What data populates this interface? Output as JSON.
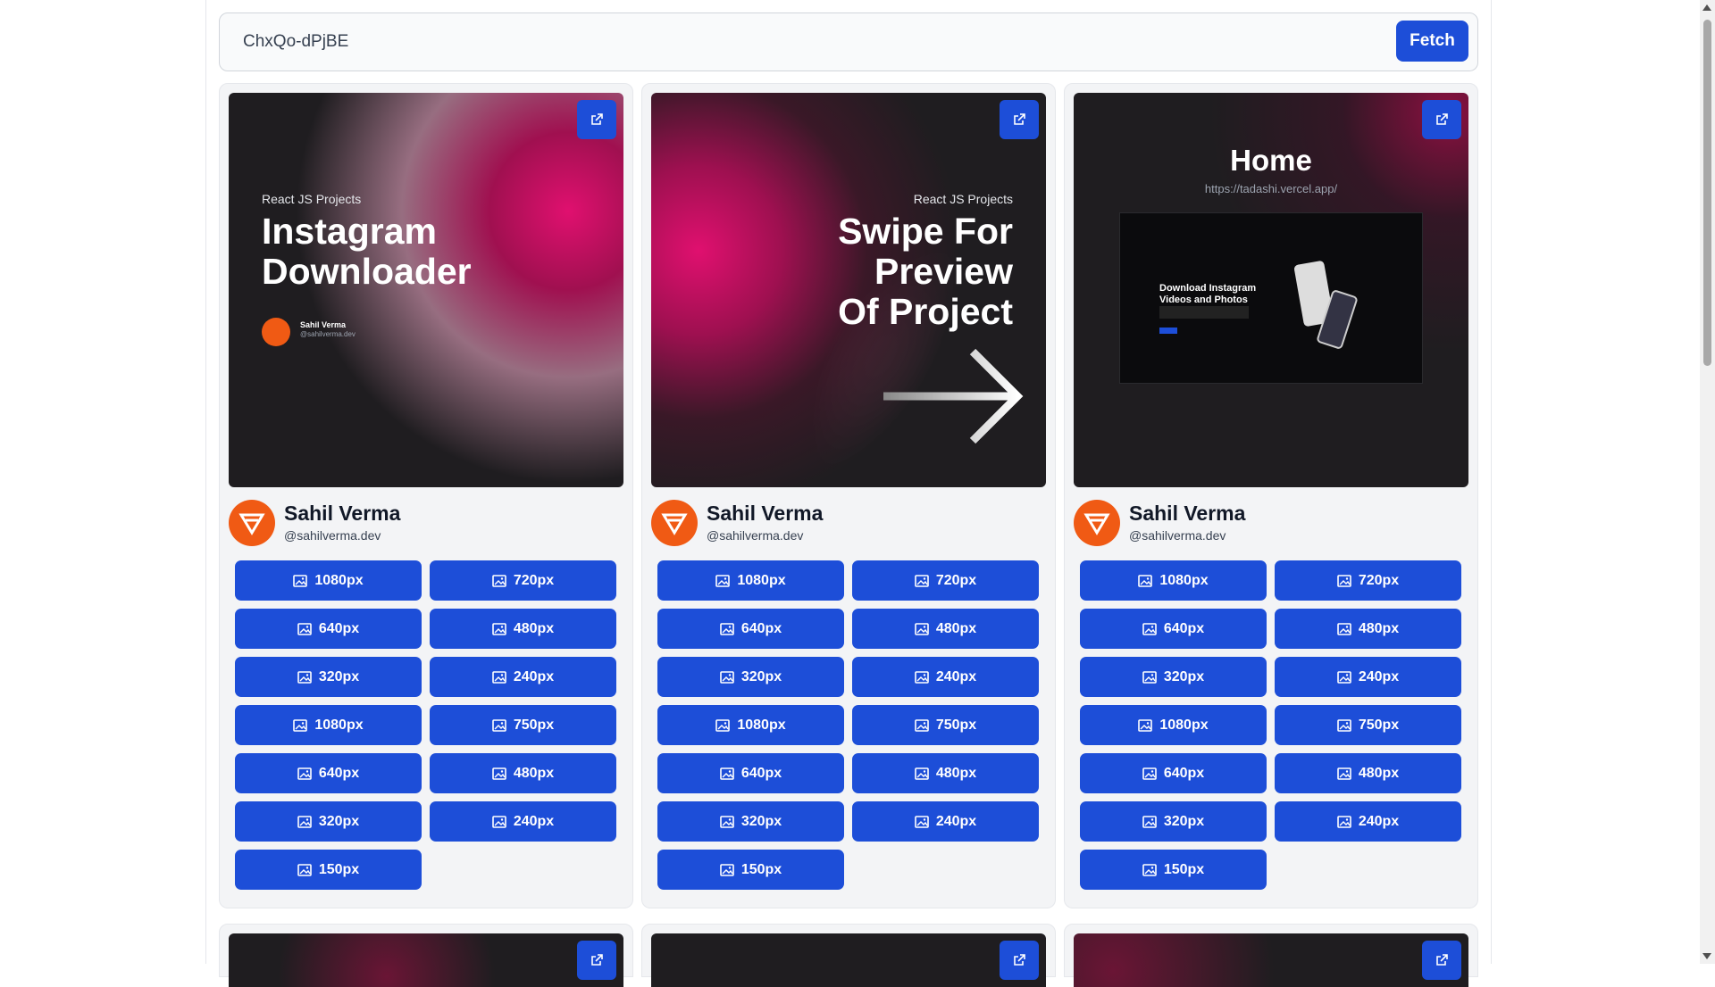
{
  "search": {
    "value": "ChxQo-dPjBE",
    "button": "Fetch"
  },
  "cards": [
    {
      "slide": {
        "kicker": "React JS Projects",
        "title_lines": [
          "Instagram",
          "Downloader"
        ],
        "author": "Sahil Verma",
        "handle": "@sahilverma.dev"
      },
      "author": {
        "name": "Sahil Verma",
        "handle": "@sahilverma.dev"
      },
      "buttons": [
        "1080px",
        "720px",
        "640px",
        "480px",
        "320px",
        "240px",
        "1080px",
        "750px",
        "640px",
        "480px",
        "320px",
        "240px",
        "150px"
      ]
    },
    {
      "slide": {
        "kicker": "React JS Projects",
        "title_lines": [
          "Swipe For",
          "Preview",
          "Of Project"
        ]
      },
      "author": {
        "name": "Sahil Verma",
        "handle": "@sahilverma.dev"
      },
      "buttons": [
        "1080px",
        "720px",
        "640px",
        "480px",
        "320px",
        "240px",
        "1080px",
        "750px",
        "640px",
        "480px",
        "320px",
        "240px",
        "150px"
      ]
    },
    {
      "slide": {
        "title": "Home",
        "url": "https://tadashi.vercel.app/",
        "mock_heading_lines": [
          "Download Instagram",
          "Videos and Photos"
        ]
      },
      "author": {
        "name": "Sahil Verma",
        "handle": "@sahilverma.dev"
      },
      "buttons": [
        "1080px",
        "720px",
        "640px",
        "480px",
        "320px",
        "240px",
        "1080px",
        "750px",
        "640px",
        "480px",
        "320px",
        "240px",
        "150px"
      ]
    }
  ],
  "colors": {
    "accent": "#1d4ed8",
    "avatar": "#f05a14",
    "pink_glow": "#e0106f"
  },
  "icons": {
    "open": "external-link-icon",
    "image": "image-icon",
    "avatar": "logo-icon"
  }
}
